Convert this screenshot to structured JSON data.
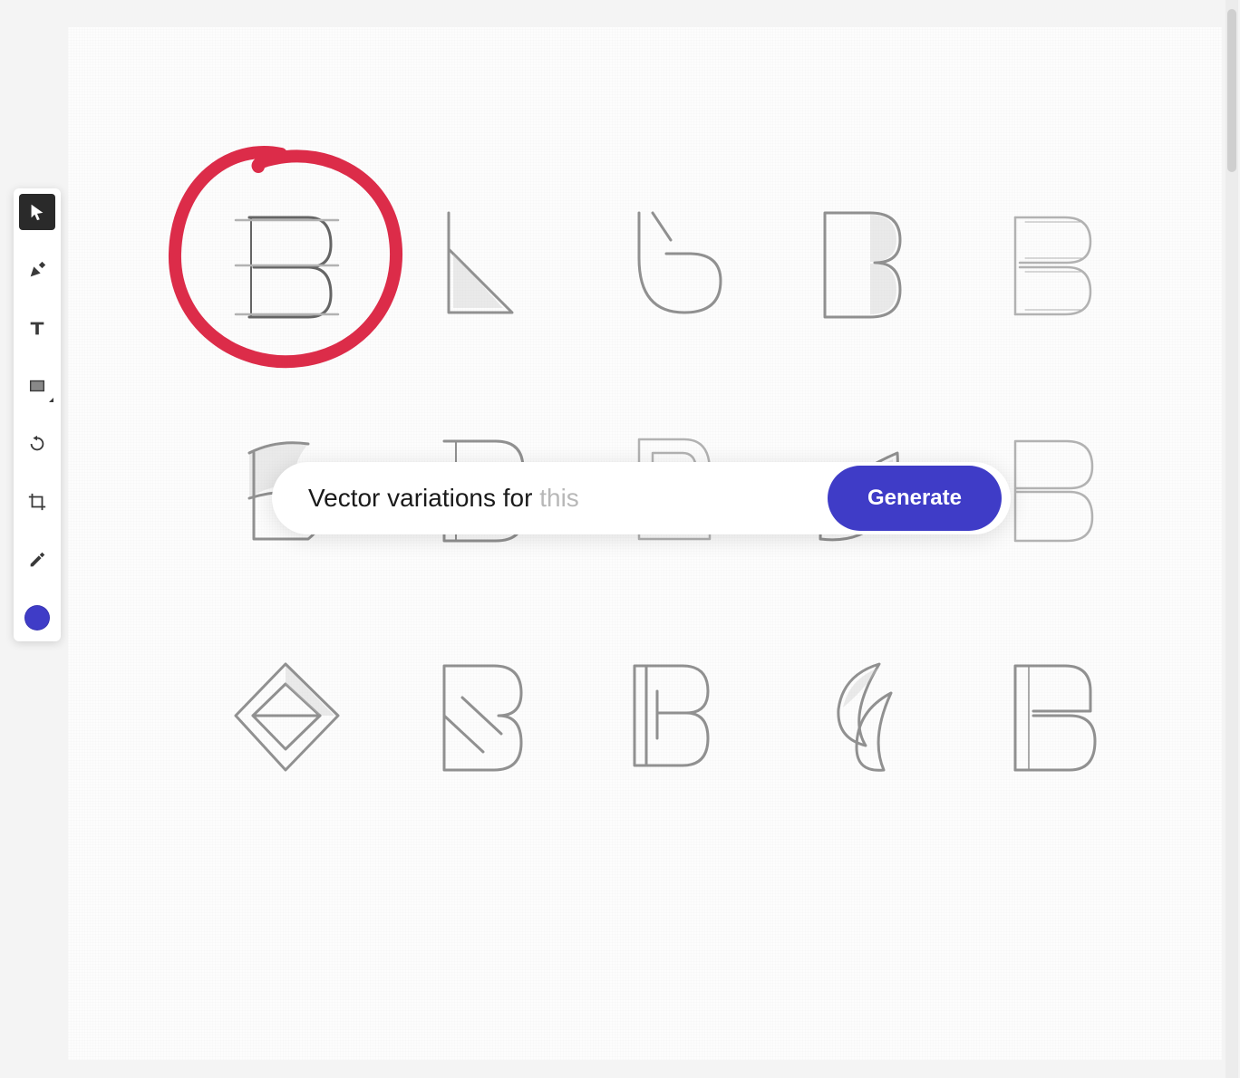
{
  "toolbar": {
    "tools": [
      {
        "name": "selection-tool",
        "icon": "cursor-icon",
        "active": true
      },
      {
        "name": "pen-tool",
        "icon": "pen-icon",
        "active": false
      },
      {
        "name": "type-tool",
        "icon": "type-icon",
        "active": false
      },
      {
        "name": "rectangle-tool",
        "icon": "rectangle-icon",
        "active": false
      },
      {
        "name": "rotate-tool",
        "icon": "rotate-icon",
        "active": false
      },
      {
        "name": "crop-tool",
        "icon": "crop-icon",
        "active": false
      },
      {
        "name": "eyedropper-tool",
        "icon": "eyedropper-icon",
        "active": false
      }
    ],
    "fill_color": "#3f3cc7"
  },
  "prompt_bar": {
    "typed_text": "Vector variations for ",
    "placeholder_tail": "this",
    "generate_label": "Generate"
  },
  "annotation": {
    "color": "#dc2c49"
  },
  "canvas": {
    "sketch_subject": "B letter logo concepts",
    "grid_rows": 3,
    "grid_cols": 5,
    "selected_index": 0
  }
}
